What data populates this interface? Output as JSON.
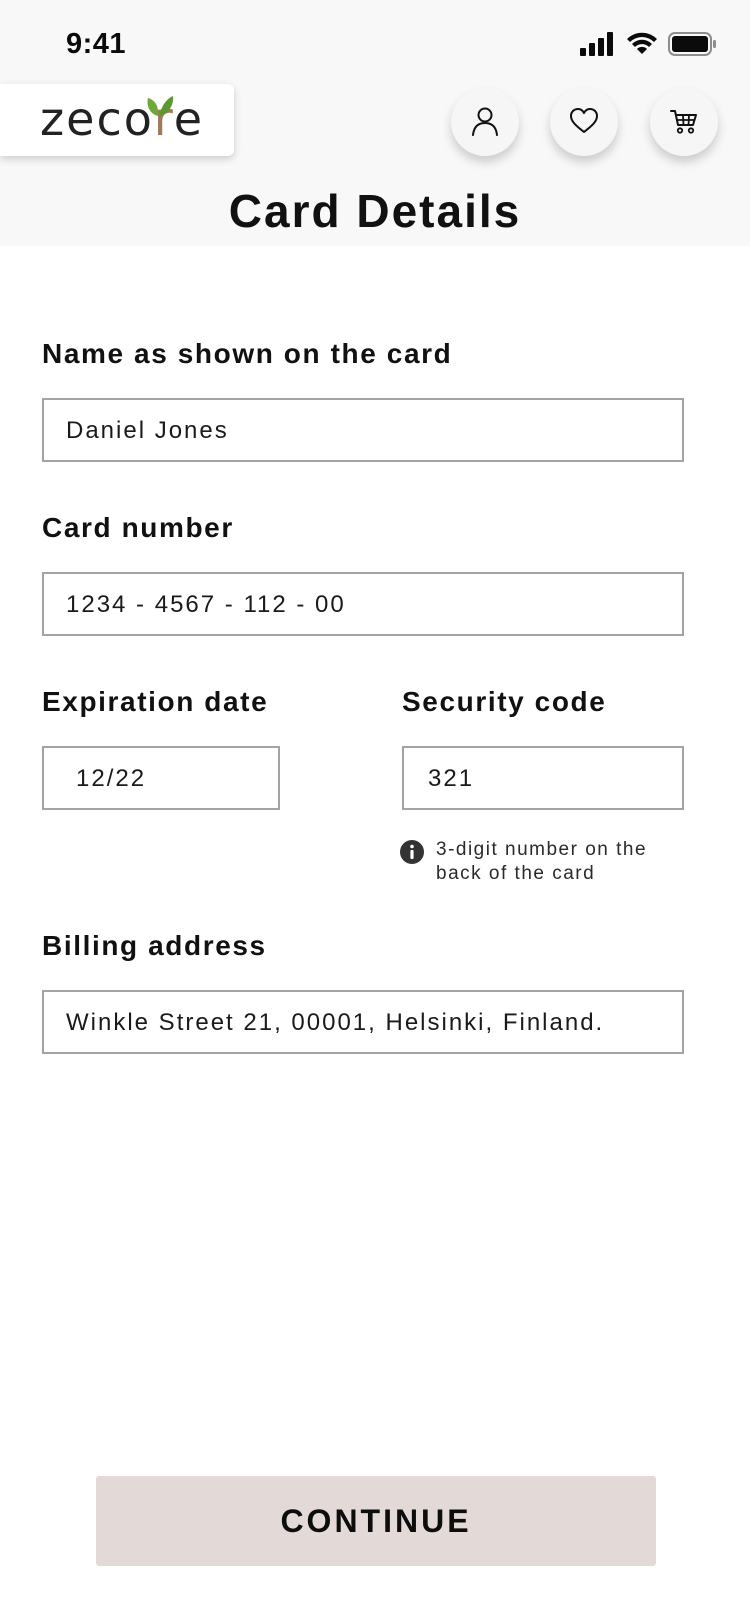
{
  "status_bar": {
    "time": "9:41",
    "icons": [
      "cellular-signal-icon",
      "wifi-icon",
      "battery-icon"
    ]
  },
  "header": {
    "logo_text": "zecore",
    "actions": [
      {
        "icon": "user-icon"
      },
      {
        "icon": "heart-icon"
      },
      {
        "icon": "cart-icon"
      }
    ]
  },
  "page": {
    "title": "Card Details"
  },
  "form": {
    "name": {
      "label": "Name as shown on the card",
      "value": "Daniel Jones"
    },
    "card_number": {
      "label": "Card number",
      "value": "1234 - 4567 - 112 - 00"
    },
    "expiration": {
      "label": "Expiration date",
      "value": "12/22"
    },
    "security": {
      "label": "Security code",
      "value": "321",
      "hint": "3-digit number on the back of the card"
    },
    "billing": {
      "label": "Billing address",
      "value": "Winkle Street 21, 00001, Helsinki, Finland."
    }
  },
  "continue_label": "CONTINUE",
  "colors": {
    "top_background": "#f8f8f8",
    "button_background": "#e3d9d6",
    "field_border": "#a3a3a3",
    "leaf_green": "#6fa83a",
    "logo_r_brown": "#a07a58"
  }
}
